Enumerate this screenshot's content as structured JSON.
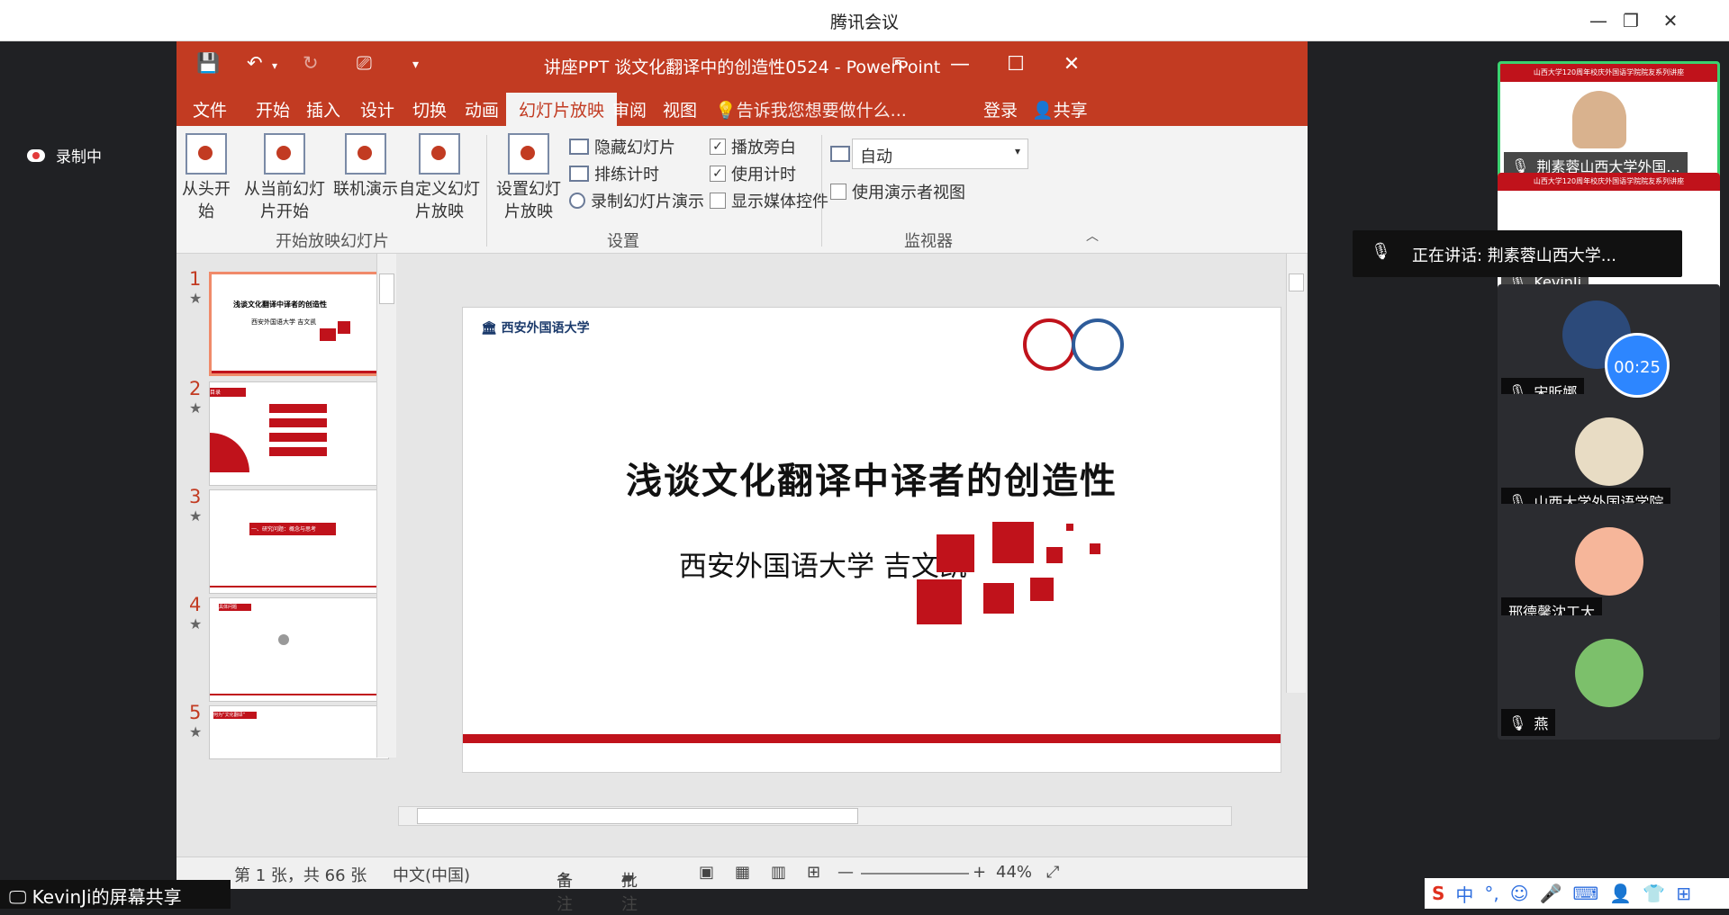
{
  "app": {
    "title": "腾讯会议"
  },
  "recording": {
    "label": "录制中"
  },
  "ppt": {
    "doc_title": "讲座PPT 谈文化翻译中的创造性0524 - PowerPoint",
    "tabs": [
      "文件",
      "开始",
      "插入",
      "设计",
      "切换",
      "动画",
      "幻灯片放映",
      "审阅",
      "视图"
    ],
    "tell_me": "告诉我您想要做什么...",
    "login": "登录",
    "share": "共享",
    "ribbon": {
      "from_start": "从头开始",
      "from_current": "从当前幻灯片开始",
      "online": "联机演示",
      "custom": "自定义幻灯片放映",
      "group_start": "开始放映幻灯片",
      "setup": "设置幻灯片放映",
      "hide_slide": "隐藏幻灯片",
      "rehearse": "排练计时",
      "record": "录制幻灯片演示",
      "play_narrations": "播放旁白",
      "use_timings": "使用计时",
      "show_media": "显示媒体控件",
      "group_setup": "设置",
      "monitor_value": "自动",
      "presenter_view": "使用演示者视图",
      "group_monitor": "监视器"
    },
    "slide": {
      "logo_text": "西安外国语大学",
      "heading": "浅谈文化翻译中译者的创造性",
      "subtitle": "西安外国语大学 吉文凯"
    },
    "thumbs": [
      {
        "num": "1",
        "title": "浅谈文化翻译中译者的创造性",
        "sub": "西安外国语大学 吉文凯"
      },
      {
        "num": "2",
        "title": "目录"
      },
      {
        "num": "3",
        "title": "一、研究问题：概念与思考"
      },
      {
        "num": "4",
        "title": "具体问题"
      },
      {
        "num": "5",
        "title": "何为“文化翻译”"
      }
    ],
    "status": {
      "slide_info": "第 1 张，共 66 张",
      "language": "中文(中国)",
      "notes": "备注",
      "comments": "批注",
      "zoom": "44%"
    }
  },
  "participants": [
    {
      "name": "荆素蓉山西大学外国...",
      "badge": "山西大学120周年校庆外国语学院院友系列讲座"
    },
    {
      "name": "KevinJi",
      "badge": "山西大学120周年校庆外国语学院院友系列讲座"
    },
    {
      "name": "宋昕娜"
    },
    {
      "name": "山西大学外国语学院"
    },
    {
      "name": "邢德馨沈工大"
    },
    {
      "name": "燕"
    }
  ],
  "speaking": {
    "label": "正在讲话: 荆素蓉山西大学..."
  },
  "timer": {
    "value": "00:25"
  },
  "screen_share": {
    "label": "KevinJi的屏幕共享"
  },
  "ime": {
    "items": [
      "中",
      "°,",
      "☺",
      "🎤",
      "⌨",
      "👤",
      "👕",
      "⊞"
    ]
  },
  "colors": {
    "ppt_red": "#c23b22",
    "slide_red": "#c0121b",
    "meeting_bg": "#202124",
    "blue": "#2d86ff"
  }
}
